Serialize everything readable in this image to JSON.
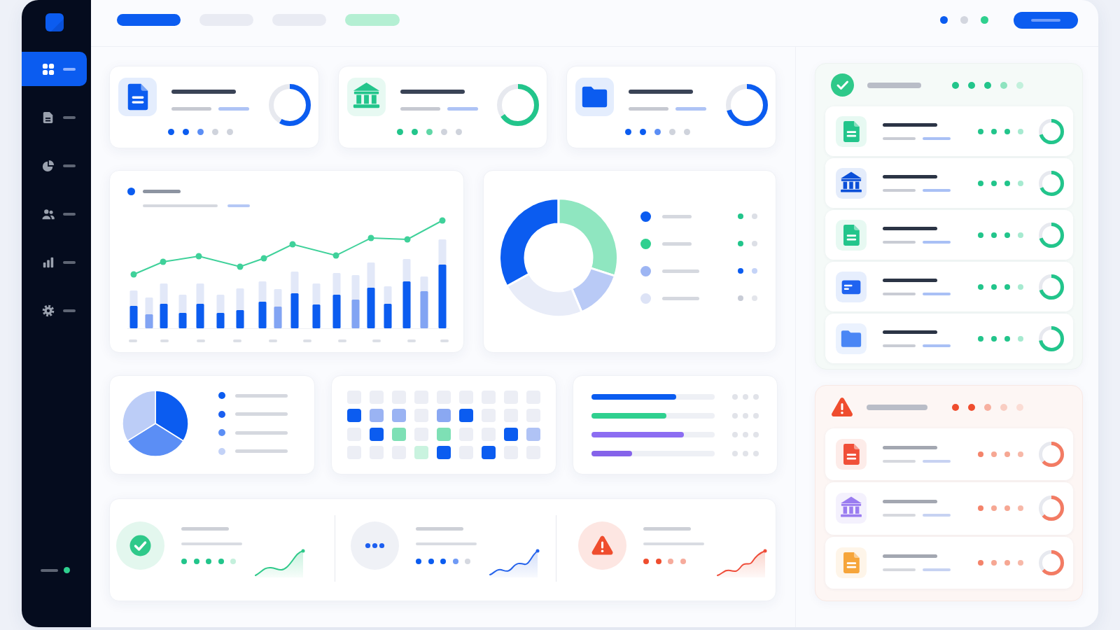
{
  "sidebar": {
    "items": [
      {
        "selected": true
      },
      {
        "selected": false
      },
      {
        "selected": false
      },
      {
        "selected": false
      },
      {
        "selected": false
      },
      {
        "selected": false
      }
    ]
  },
  "top_bar": {
    "nav_pills": [
      {
        "color": "#0b5cf0"
      },
      {
        "color": "#e9ebf3"
      },
      {
        "color": "#e9ebf3"
      },
      {
        "color": "#b4efd3"
      }
    ],
    "status_dots": [
      {
        "color": "#0b5cf0"
      },
      {
        "color": "#d3d6df"
      },
      {
        "color": "#2fd08f"
      }
    ]
  },
  "stat_cards": [
    {
      "color": "#0b5cf0",
      "level": 0.58,
      "dots": [
        {
          "color": "#0b5cf0"
        },
        {
          "color": "#0b5cf0"
        },
        {
          "color": "#5b8ef5"
        },
        {
          "color": "#cfd3dc"
        },
        {
          "color": "#cfd3dc"
        }
      ]
    },
    {
      "color": "#22c58b",
      "level": 0.65,
      "dots": [
        {
          "color": "#22c58b"
        },
        {
          "color": "#22c58b"
        },
        {
          "color": "#5fd7a6"
        },
        {
          "color": "#cfd3dc"
        },
        {
          "color": "#cfd3dc"
        }
      ]
    },
    {
      "color": "#0b5cf0",
      "level": 0.7,
      "dots": [
        {
          "color": "#0b5cf0"
        },
        {
          "color": "#0b5cf0"
        },
        {
          "color": "#5b8ef5"
        },
        {
          "color": "#cfd3dc"
        },
        {
          "color": "#cfd3dc"
        }
      ]
    }
  ],
  "donut_card": {
    "legend": [
      {
        "color": "#0b5cf0",
        "status": [
          {
            "color": "#22c58b"
          },
          {
            "color": "#dcdfe6"
          }
        ]
      },
      {
        "color": "#2fd08f",
        "status": [
          {
            "color": "#22c58b"
          },
          {
            "color": "#dcdfe6"
          }
        ]
      },
      {
        "color": "#9db5f3",
        "status": [
          {
            "color": "#0b5cf0"
          },
          {
            "color": "#c4d3f7"
          }
        ]
      },
      {
        "color": "#dde3f6",
        "status": [
          {
            "color": "#c8ccd6"
          },
          {
            "color": "#e3e5eb"
          }
        ]
      }
    ]
  },
  "pie_card": {
    "legend": [
      {
        "color": "#0b5cf0"
      },
      {
        "color": "#1a5ff0"
      },
      {
        "color": "#5b8ef5"
      },
      {
        "color": "#c3d2f7"
      }
    ]
  },
  "heatmap_card": {
    "rows": [
      [
        {
          "color": "#eceef5"
        },
        {
          "color": "#eceef5"
        },
        {
          "color": "#eceef5"
        },
        {
          "color": "#eceef5"
        },
        {
          "color": "#eceef5"
        },
        {
          "color": "#eceef5"
        },
        {
          "color": "#eceef5"
        },
        {
          "color": "#eceef5"
        },
        {
          "color": "#eceef5"
        }
      ],
      [
        {
          "color": "#0b5cf0"
        },
        {
          "color": "#9ab3f3"
        },
        {
          "color": "#9ab3f3"
        },
        {
          "color": "#eceef5"
        },
        {
          "color": "#8aa8f2"
        },
        {
          "color": "#0b5cf0"
        },
        {
          "color": "#eceef5"
        },
        {
          "color": "#eceef5"
        },
        {
          "color": "#eceef5"
        }
      ],
      [
        {
          "color": "#eceef5"
        },
        {
          "color": "#0b5cf0"
        },
        {
          "color": "#7ee0b5"
        },
        {
          "color": "#eceef5"
        },
        {
          "color": "#7ee0b5"
        },
        {
          "color": "#eceef5"
        },
        {
          "color": "#eceef5"
        },
        {
          "color": "#0b5cf0"
        },
        {
          "color": "#b0c3f5"
        }
      ],
      [
        {
          "color": "#eceef5"
        },
        {
          "color": "#eceef5"
        },
        {
          "color": "#eceef5"
        },
        {
          "color": "#c9f3df"
        },
        {
          "color": "#0b5cf0"
        },
        {
          "color": "#eceef5"
        },
        {
          "color": "#0b5cf0"
        },
        {
          "color": "#eceef5"
        },
        {
          "color": "#eceef5"
        }
      ]
    ]
  },
  "progress_card": {
    "bars": [
      {
        "color": "#0b5cf0",
        "level": 0.69
      },
      {
        "color": "#2fd08f",
        "level": 0.61
      },
      {
        "color": "#8c6df2",
        "level": 0.75
      },
      {
        "color": "#8563ea",
        "level": 0.33
      }
    ]
  },
  "summary_sections": [
    {
      "kind": "success",
      "dots": [
        {
          "color": "#22c58b"
        },
        {
          "color": "#22c58b"
        },
        {
          "color": "#22c58b"
        },
        {
          "color": "#22c58b"
        },
        {
          "color": "#c4f0dc"
        }
      ]
    },
    {
      "kind": "pending",
      "dots": [
        {
          "color": "#0b5cf0"
        },
        {
          "color": "#0b5cf0"
        },
        {
          "color": "#0b5cf0"
        },
        {
          "color": "#6f9af5"
        },
        {
          "color": "#d5d8e0"
        }
      ]
    },
    {
      "kind": "warning",
      "dots": [
        {
          "color": "#ef4d2e"
        },
        {
          "color": "#ef4d2e"
        },
        {
          "color": "#f6ab9c"
        },
        {
          "color": "#f6ab9c"
        }
      ]
    }
  ],
  "side_panels": [
    {
      "kind": "success",
      "dots": [
        {
          "color": "#22c58b"
        },
        {
          "color": "#22c58b"
        },
        {
          "color": "#22c58b"
        },
        {
          "color": "#8ee3bf"
        },
        {
          "color": "#c2f0dc"
        }
      ],
      "rows": [
        {
          "color": "#22c58b",
          "level": 0.7,
          "dots": [
            {
              "color": "#22c58b"
            },
            {
              "color": "#22c58b"
            },
            {
              "color": "#22c58b"
            },
            {
              "color": "#a6ead0"
            }
          ]
        },
        {
          "color": "#0b4fd8",
          "level": 0.68,
          "dots": [
            {
              "color": "#22c58b"
            },
            {
              "color": "#22c58b"
            },
            {
              "color": "#22c58b"
            },
            {
              "color": "#a6ead0"
            }
          ]
        },
        {
          "color": "#22c58b",
          "level": 0.7,
          "dots": [
            {
              "color": "#22c58b"
            },
            {
              "color": "#22c58b"
            },
            {
              "color": "#22c58b"
            },
            {
              "color": "#a6ead0"
            }
          ]
        },
        {
          "color": "#1f63f0",
          "level": 0.7,
          "dots": [
            {
              "color": "#22c58b"
            },
            {
              "color": "#22c58b"
            },
            {
              "color": "#22c58b"
            },
            {
              "color": "#a6ead0"
            }
          ]
        },
        {
          "color": "#4a86f5",
          "level": 0.72,
          "dots": [
            {
              "color": "#22c58b"
            },
            {
              "color": "#22c58b"
            },
            {
              "color": "#22c58b"
            },
            {
              "color": "#a6ead0"
            }
          ]
        }
      ]
    },
    {
      "kind": "warning",
      "dots": [
        {
          "color": "#ef4d2e"
        },
        {
          "color": "#ef4d2e"
        },
        {
          "color": "#f7b0a0"
        },
        {
          "color": "#f9cdc2"
        },
        {
          "color": "#fbdcd4"
        }
      ],
      "rows": [
        {
          "color": "#f04f38",
          "level": 0.63,
          "dots": [
            {
              "color": "#f4836a"
            },
            {
              "color": "#f6a793"
            },
            {
              "color": "#f6a793"
            },
            {
              "color": "#f7b8a8"
            }
          ]
        },
        {
          "color": "#9a7cf0",
          "level": 0.63,
          "dots": [
            {
              "color": "#f4836a"
            },
            {
              "color": "#f6a793"
            },
            {
              "color": "#f6a793"
            },
            {
              "color": "#f7b8a8"
            }
          ]
        },
        {
          "color": "#f6a53a",
          "level": 0.63,
          "dots": [
            {
              "color": "#f4836a"
            },
            {
              "color": "#f6a793"
            },
            {
              "color": "#f6a793"
            },
            {
              "color": "#f7b8a8"
            }
          ]
        }
      ]
    }
  ]
}
